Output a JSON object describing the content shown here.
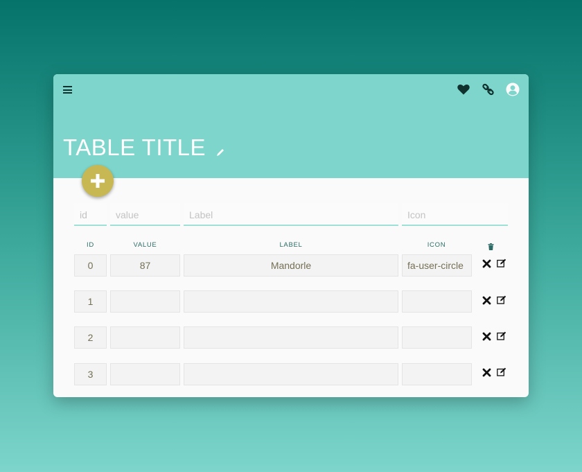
{
  "header": {
    "title": "TABLE TITLE",
    "icons": [
      "menu-icon",
      "heart-icon",
      "link-icon",
      "user-circle-icon"
    ]
  },
  "filters": {
    "id_placeholder": "id",
    "value_placeholder": "value",
    "label_placeholder": "Label",
    "icon_placeholder": "Icon"
  },
  "columns": {
    "id": "ID",
    "value": "VALUE",
    "label": "LABEL",
    "icon": "ICON",
    "delete_all_icon": "trash-icon"
  },
  "rows": [
    {
      "id": "0",
      "value": "87",
      "label": "Mandorle",
      "icon": "fa-user-circle"
    },
    {
      "id": "1",
      "value": "",
      "label": "",
      "icon": ""
    },
    {
      "id": "2",
      "value": "",
      "label": "",
      "icon": ""
    },
    {
      "id": "3",
      "value": "",
      "label": "",
      "icon": ""
    }
  ],
  "colors": {
    "header_bg": "#7dd5cb",
    "accent_button": "#c7b853",
    "cell_text": "#746f55",
    "icon_dark": "#10322e"
  }
}
